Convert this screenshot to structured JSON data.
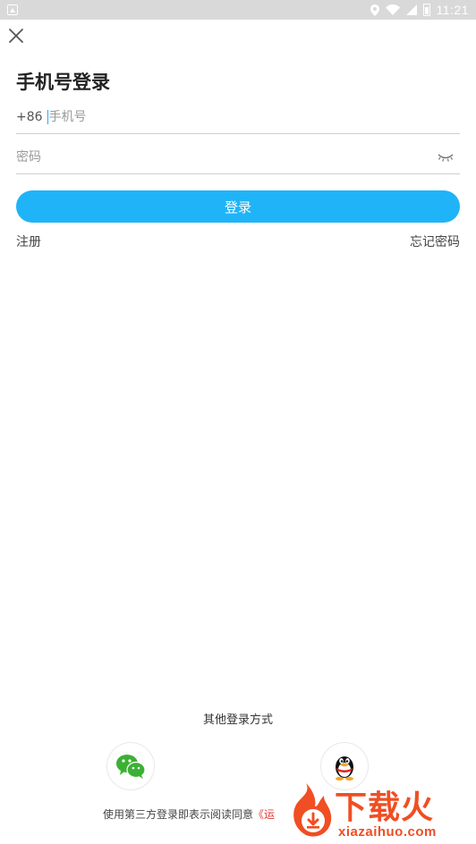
{
  "status_bar": {
    "time": "11:21",
    "icons": [
      "notification-icon",
      "location-icon",
      "wifi-icon",
      "signal-icon",
      "battery-icon"
    ]
  },
  "header": {
    "close_icon": "close-icon",
    "title": "手机号登录"
  },
  "form": {
    "country_code": "+86",
    "phone_placeholder": "手机号",
    "phone_value": "",
    "password_placeholder": "密码",
    "password_value": "",
    "eye_icon": "eye-closed-icon",
    "login_label": "登录"
  },
  "links": {
    "register": "注册",
    "forgot_password": "忘记密码"
  },
  "other_login": {
    "title": "其他登录方式",
    "providers": [
      {
        "icon": "wechat-icon"
      },
      {
        "icon": "qq-icon"
      }
    ]
  },
  "agreement": {
    "text": "使用第三方登录即表示阅读同意",
    "protocol_partial": "《运"
  },
  "watermark": {
    "title": "下载火",
    "subtitle": "xiazaihuo.com"
  },
  "colors": {
    "primary": "#1fb4f7",
    "accent_red": "#e53935",
    "watermark": "#f04e23"
  }
}
